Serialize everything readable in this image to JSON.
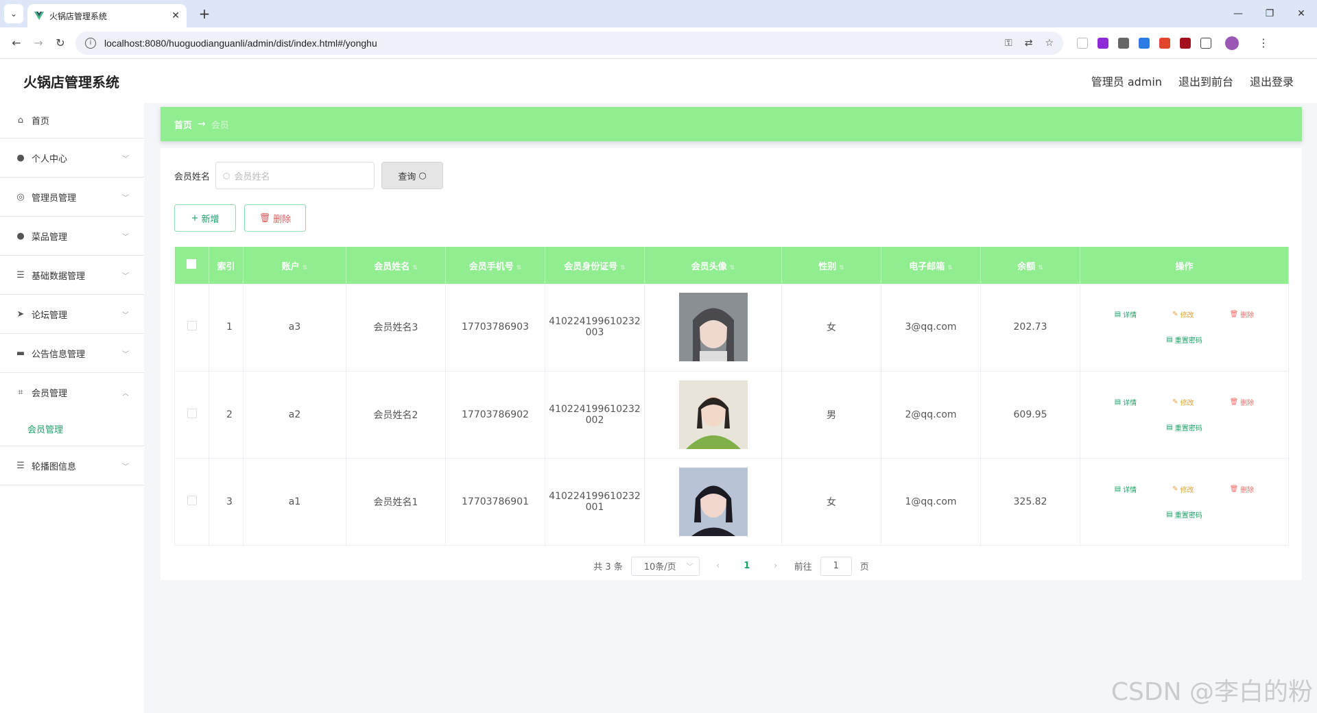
{
  "browser": {
    "tab_title": "火锅店管理系统",
    "url": "localhost:8080/huoguodianguanli/admin/dist/index.html#/yonghu"
  },
  "header": {
    "title": "火锅店管理系统",
    "role_user": "管理员 admin",
    "to_frontend": "退出到前台",
    "logout": "退出登录"
  },
  "sidebar": {
    "items": [
      {
        "label": "首页",
        "icon": "home-icon"
      },
      {
        "label": "个人中心",
        "icon": "user-icon"
      },
      {
        "label": "管理员管理",
        "icon": "compass-icon"
      },
      {
        "label": "菜品管理",
        "icon": "user-icon"
      },
      {
        "label": "基础数据管理",
        "icon": "list-icon"
      },
      {
        "label": "论坛管理",
        "icon": "send-icon"
      },
      {
        "label": "公告信息管理",
        "icon": "briefcase-icon"
      },
      {
        "label": "会员管理",
        "icon": "crop-icon"
      },
      {
        "label": "轮播图信息",
        "icon": "list-icon"
      }
    ],
    "submenu_active": "会员管理"
  },
  "breadcrumb": {
    "home": "首页",
    "current": "会员"
  },
  "search": {
    "label": "会员姓名",
    "placeholder": "会员姓名",
    "query_label": "查询"
  },
  "actions": {
    "add_label": "新增",
    "delete_label": "删除"
  },
  "table": {
    "headers": [
      "索引",
      "账户",
      "会员姓名",
      "会员手机号",
      "会员身份证号",
      "会员头像",
      "性别",
      "电子邮箱",
      "余额",
      "操作"
    ],
    "rows": [
      {
        "index": "1",
        "account": "a3",
        "name": "会员姓名3",
        "phone": "17703786903",
        "id_card_1": "410224199610232",
        "id_card_2": "003",
        "gender": "女",
        "email": "3@qq.com",
        "balance": "202.73"
      },
      {
        "index": "2",
        "account": "a2",
        "name": "会员姓名2",
        "phone": "17703786902",
        "id_card_1": "410224199610232",
        "id_card_2": "002",
        "gender": "男",
        "email": "2@qq.com",
        "balance": "609.95"
      },
      {
        "index": "3",
        "account": "a1",
        "name": "会员姓名1",
        "phone": "17703786901",
        "id_card_1": "410224199610232",
        "id_card_2": "001",
        "gender": "女",
        "email": "1@qq.com",
        "balance": "325.82"
      }
    ],
    "ops": {
      "view": "详情",
      "edit": "修改",
      "delete": "删除",
      "reset": "重置密码"
    }
  },
  "pagination": {
    "total": "共 3 条",
    "page_size": "10条/页",
    "current": "1",
    "goto_label": "前往",
    "goto_value": "1",
    "page_suffix": "页"
  },
  "watermark": "CSDN @李白的粉",
  "colors": {
    "accent_green": "#90ee90",
    "link_green": "#1aa368",
    "danger": "#f56c6c",
    "warning": "#e6a23c"
  }
}
